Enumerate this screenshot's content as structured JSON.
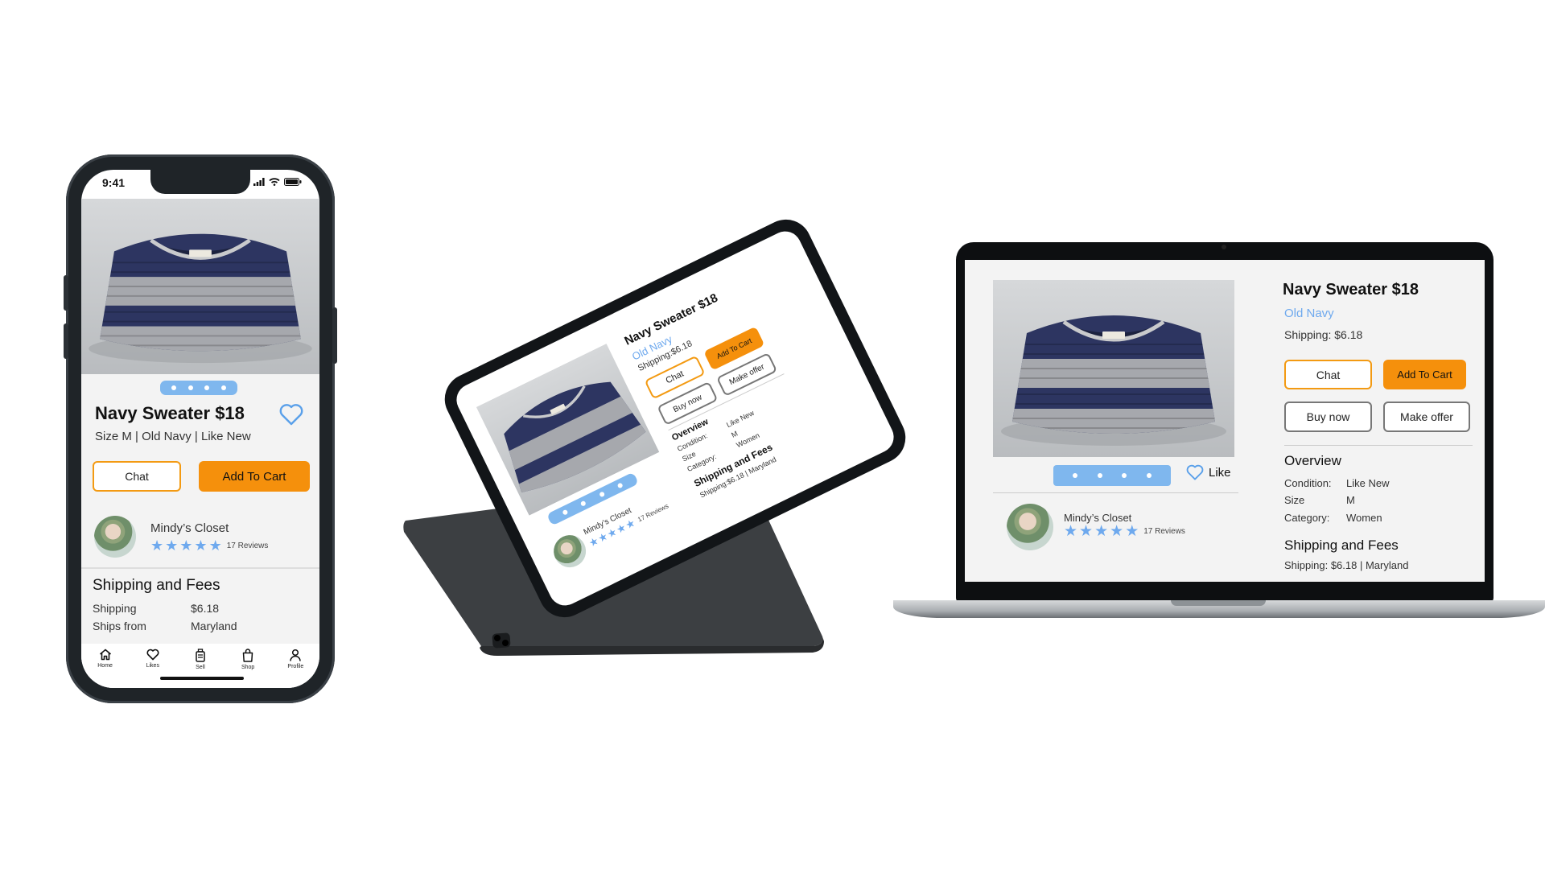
{
  "product": {
    "title": "Navy Sweater $18",
    "brand": "Old Navy",
    "mobile_subtitle": "Size M | Old Navy | Like New",
    "shipping_short": "Shipping: $6.18",
    "shipping_short_tablet": "Shipping:$6.18"
  },
  "actions": {
    "chat": "Chat",
    "add_to_cart": "Add To Cart",
    "buy_now": "Buy now",
    "make_offer": "Make offer",
    "like": "Like"
  },
  "seller": {
    "name": "Mindy’s Closet",
    "rating_stars": 5,
    "reviews": "17 Reviews"
  },
  "overview": {
    "title": "Overview",
    "rows": [
      {
        "label": "Condition:",
        "value": "Like New"
      },
      {
        "label": "Size",
        "value": "M"
      },
      {
        "label": "Category:",
        "value": "Women"
      }
    ]
  },
  "shipping": {
    "title": "Shipping and Fees",
    "summary": "Shipping: $6.18 | Maryland",
    "summary_tablet": "Shipping:$6.18 | Maryland",
    "rows": [
      {
        "label": "Shipping",
        "value": "$6.18"
      },
      {
        "label": "Ships from",
        "value": "Maryland"
      }
    ]
  },
  "phone": {
    "status_time": "9:41",
    "tabs": [
      {
        "label": "Home",
        "icon": "home-icon"
      },
      {
        "label": "Likes",
        "icon": "heart-icon"
      },
      {
        "label": "Sell",
        "icon": "sell-icon"
      },
      {
        "label": "Shop",
        "icon": "shopping-bag-icon"
      },
      {
        "label": "Profile",
        "icon": "profile-icon"
      }
    ]
  },
  "carousel": {
    "mobile_dots": 4,
    "tablet_dots": 4,
    "laptop_dots": 4
  },
  "colors": {
    "accent_orange": "#f5900c",
    "accent_blue": "#6ea9ee",
    "sweater_navy": "#2d3561",
    "sweater_gray": "#a6a8ad"
  }
}
